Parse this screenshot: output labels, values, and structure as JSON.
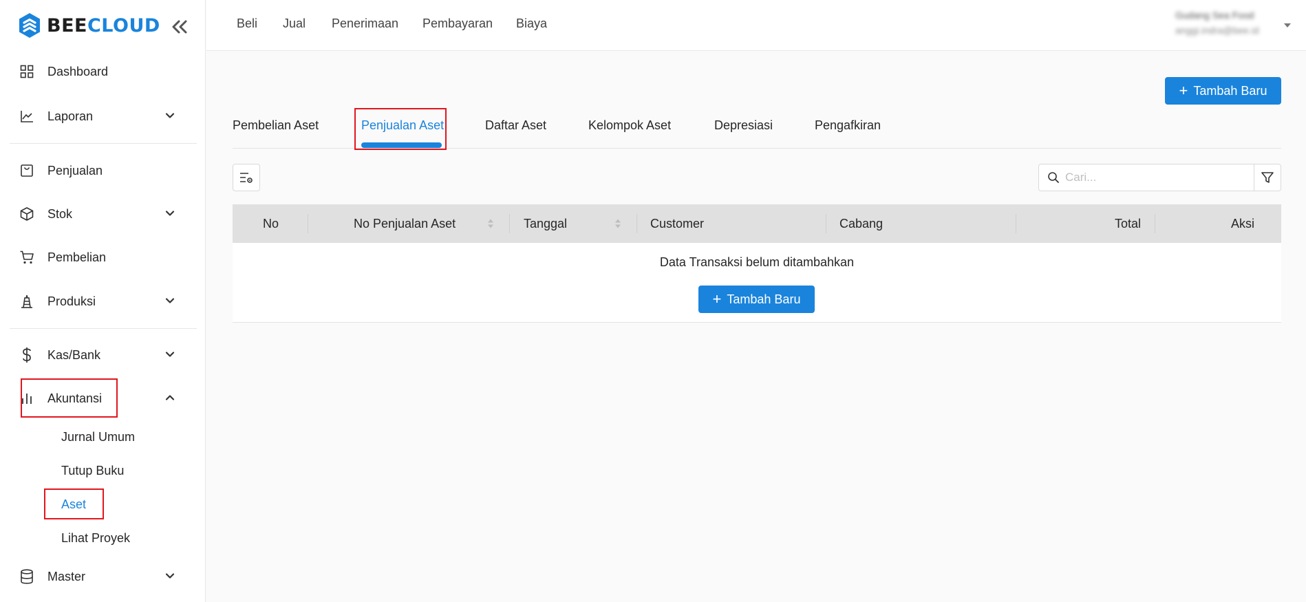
{
  "brand": {
    "part1": "BEE",
    "part2": "CLOUD"
  },
  "sidebar": {
    "items": [
      {
        "label": "Dashboard"
      },
      {
        "label": "Laporan"
      },
      {
        "label": "Penjualan"
      },
      {
        "label": "Stok"
      },
      {
        "label": "Pembelian"
      },
      {
        "label": "Produksi"
      },
      {
        "label": "Kas/Bank"
      },
      {
        "label": "Akuntansi"
      },
      {
        "label": "Master"
      }
    ],
    "akuntansi_sub": [
      {
        "label": "Jurnal Umum"
      },
      {
        "label": "Tutup Buku"
      },
      {
        "label": "Aset"
      },
      {
        "label": "Lihat Proyek"
      }
    ]
  },
  "topnav": {
    "links": [
      {
        "label": "Beli"
      },
      {
        "label": "Jual"
      },
      {
        "label": "Penerimaan"
      },
      {
        "label": "Pembayaran"
      },
      {
        "label": "Biaya"
      }
    ],
    "user_name": "Gudang Sea Food",
    "user_email": "anggi.indra@bee.id"
  },
  "main": {
    "add_button_label": "Tambah Baru",
    "tabs": [
      {
        "label": "Pembelian Aset"
      },
      {
        "label": "Penjualan Aset"
      },
      {
        "label": "Daftar Aset"
      },
      {
        "label": "Kelompok Aset"
      },
      {
        "label": "Depresiasi"
      },
      {
        "label": "Pengafkiran"
      }
    ],
    "active_tab": "Penjualan Aset",
    "search_placeholder": "Cari...",
    "table": {
      "columns": [
        "No",
        "No Penjualan Aset",
        "Tanggal",
        "Customer",
        "Cabang",
        "Total",
        "Aksi"
      ],
      "empty_text": "Data Transaksi belum ditambahkan",
      "empty_button_label": "Tambah Baru"
    }
  },
  "colors": {
    "accent": "#1a84dc",
    "highlight": "#e0161d"
  }
}
